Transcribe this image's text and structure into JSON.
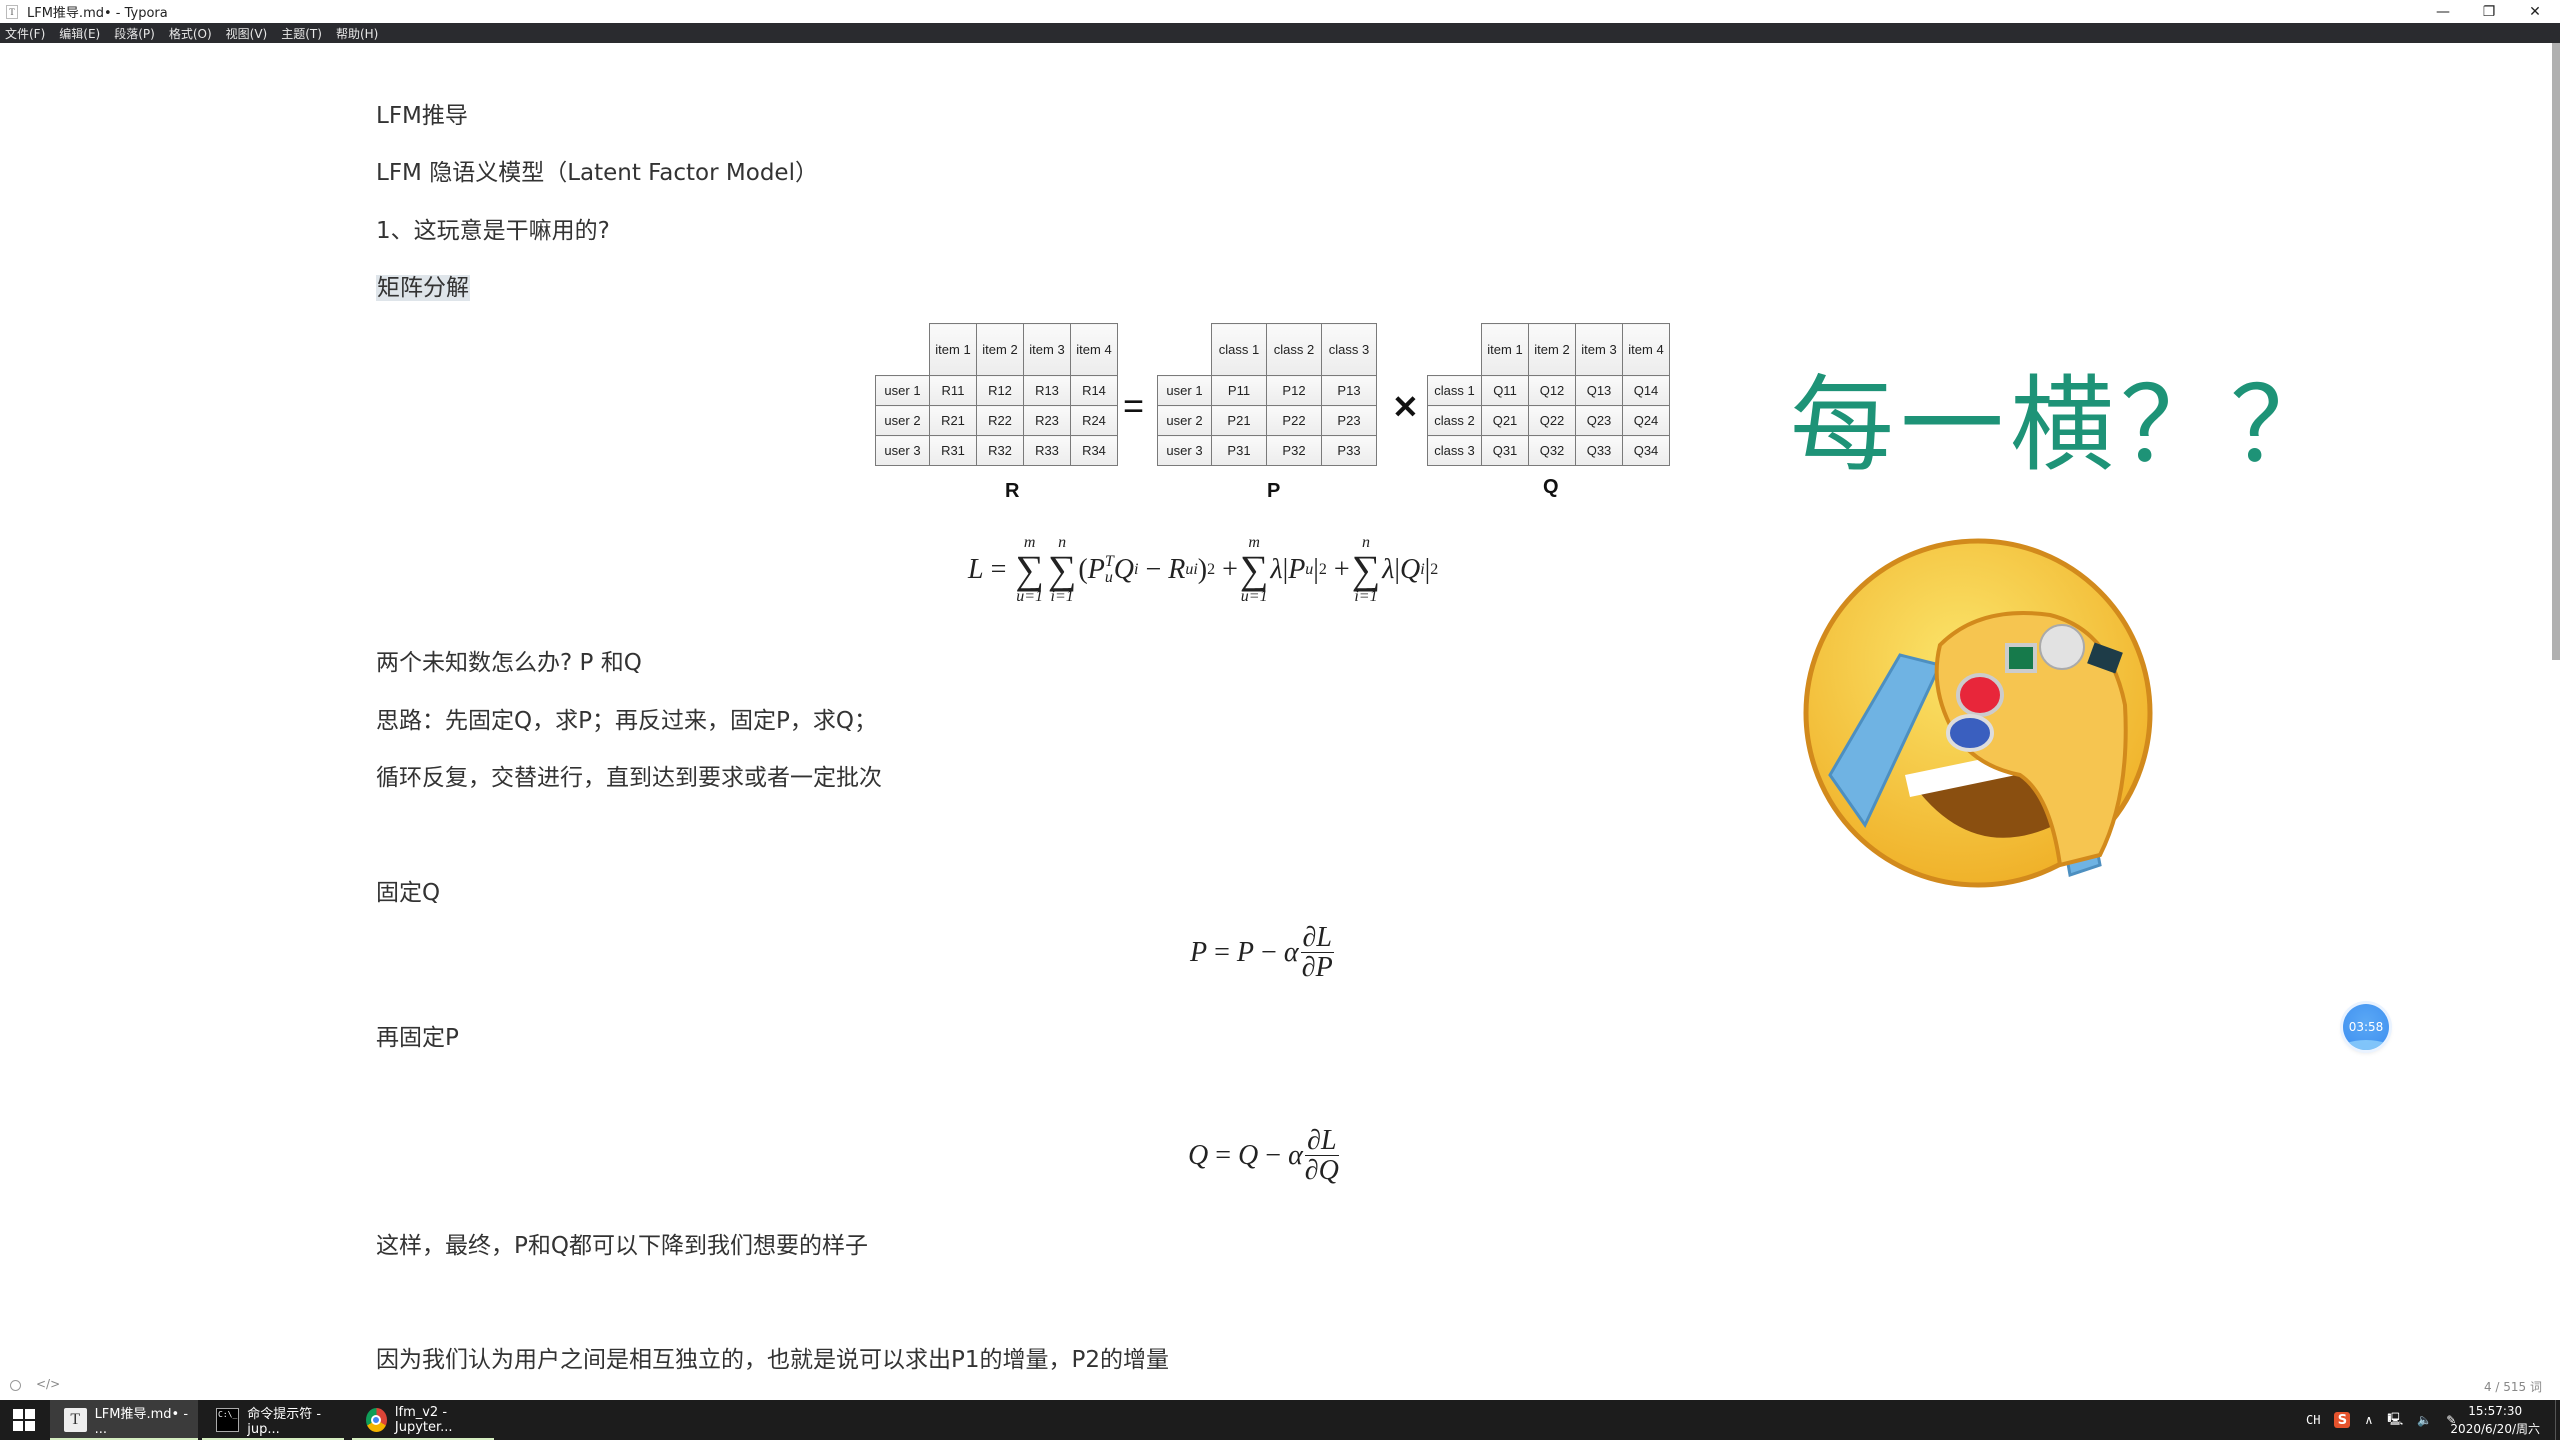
{
  "window": {
    "title": "LFM推导.md• - Typora",
    "app_icon": "T",
    "controls": {
      "minimize": "—",
      "maximize": "❐",
      "close": "✕"
    }
  },
  "menubar": {
    "items": [
      "文件(F)",
      "编辑(E)",
      "段落(P)",
      "格式(O)",
      "视图(V)",
      "主题(T)",
      "帮助(H)"
    ]
  },
  "document": {
    "paragraphs": {
      "p1": "LFM推导",
      "p2": "LFM 隐语义模型（Latent Factor Model）",
      "p3": "1、这玩意是干嘛用的?",
      "p4": "矩阵分解",
      "p5": "两个未知数怎么办? P 和Q",
      "p6": "思路：先固定Q，求P；再反过来，固定P，求Q；",
      "p7": "循环反复，交替进行，直到达到要求或者一定批次",
      "p8": "固定Q",
      "p9": "再固定P",
      "p10": "这样，最终，P和Q都可以下降到我们想要的样子",
      "p11": "因为我们认为用户之间是相互独立的，也就是说可以求出P1的增量，P2的增量"
    },
    "matrix_figure": {
      "R": {
        "label": "R",
        "col_headers": [
          "item 1",
          "item 2",
          "item 3",
          "item 4"
        ],
        "rows": [
          {
            "label": "user 1",
            "cells": [
              "R11",
              "R12",
              "R13",
              "R14"
            ]
          },
          {
            "label": "user 2",
            "cells": [
              "R21",
              "R22",
              "R23",
              "R24"
            ]
          },
          {
            "label": "user 3",
            "cells": [
              "R31",
              "R32",
              "R33",
              "R34"
            ]
          }
        ]
      },
      "equals": "=",
      "P": {
        "label": "P",
        "col_headers": [
          "class 1",
          "class 2",
          "class 3"
        ],
        "rows": [
          {
            "label": "user 1",
            "cells": [
              "P11",
              "P12",
              "P13"
            ]
          },
          {
            "label": "user 2",
            "cells": [
              "P21",
              "P22",
              "P23"
            ]
          },
          {
            "label": "user 3",
            "cells": [
              "P31",
              "P32",
              "P33"
            ]
          }
        ]
      },
      "times": "✕",
      "Q": {
        "label": "Q",
        "col_headers": [
          "item 1",
          "item 2",
          "item 3",
          "item 4"
        ],
        "rows": [
          {
            "label": "class 1",
            "cells": [
              "Q11",
              "Q12",
              "Q13",
              "Q14"
            ]
          },
          {
            "label": "class 2",
            "cells": [
              "Q21",
              "Q22",
              "Q23",
              "Q24"
            ]
          },
          {
            "label": "class 3",
            "cells": [
              "Q31",
              "Q32",
              "Q33",
              "Q34"
            ]
          }
        ]
      }
    },
    "formulas": {
      "loss": "L = Σ_{u=1}^{m} Σ_{i=1}^{n} (P_u^T Q_i − R_ui)^2 + Σ_{u=1}^{m} λ|P_u|^2 + Σ_{i=1}^{n} λ|Q_i|^2",
      "update_p": "P = P − α ∂L/∂P",
      "update_q": "Q = Q − α ∂L/∂Q"
    }
  },
  "overlay": {
    "meme_text": "每一横？？",
    "meme_color": "#1e9377",
    "emoji": "facepalm-laughing-emoji-with-rings",
    "timer": "03:58"
  },
  "footer": {
    "word_count": "4 / 515 词"
  },
  "taskbar": {
    "tasks": [
      {
        "label": "LFM推导.md• - ...",
        "icon": "typora-icon",
        "active": true
      },
      {
        "label": "命令提示符 - jup...",
        "icon": "cmd-icon",
        "active": false
      },
      {
        "label": "lfm_v2 - Jupyter...",
        "icon": "chrome-icon",
        "active": false
      }
    ],
    "tray": {
      "input_lang": "CH",
      "ime": "S",
      "time": "15:57:30",
      "date": "2020/6/20/周六"
    }
  }
}
